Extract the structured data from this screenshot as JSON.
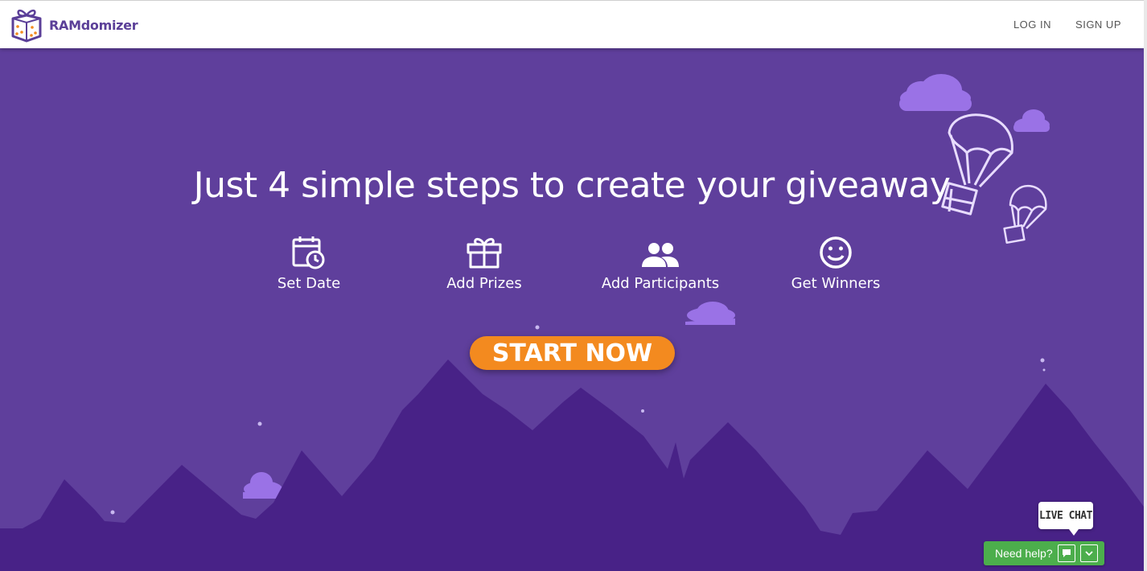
{
  "header": {
    "brand": "RAMdomizer",
    "nav": {
      "login": "LOG IN",
      "signup": "SIGN UP"
    }
  },
  "hero": {
    "headline": "Just 4 simple steps to create your giveaway",
    "steps": [
      {
        "label": "Set Date",
        "icon": "calendar-clock-icon"
      },
      {
        "label": "Add Prizes",
        "icon": "gift-icon"
      },
      {
        "label": "Add Participants",
        "icon": "people-icon"
      },
      {
        "label": "Get Winners",
        "icon": "smiley-icon"
      }
    ],
    "cta": "START NOW"
  },
  "chat": {
    "bubble": "LIVE CHAT",
    "help": "Need help?"
  },
  "colors": {
    "sky": "#5f3f9c",
    "mountains": "#482287",
    "cloud": "#9a72e6",
    "cta": "#f38a1f",
    "help_bar": "#4cae4c",
    "brand": "#5b3f98"
  }
}
